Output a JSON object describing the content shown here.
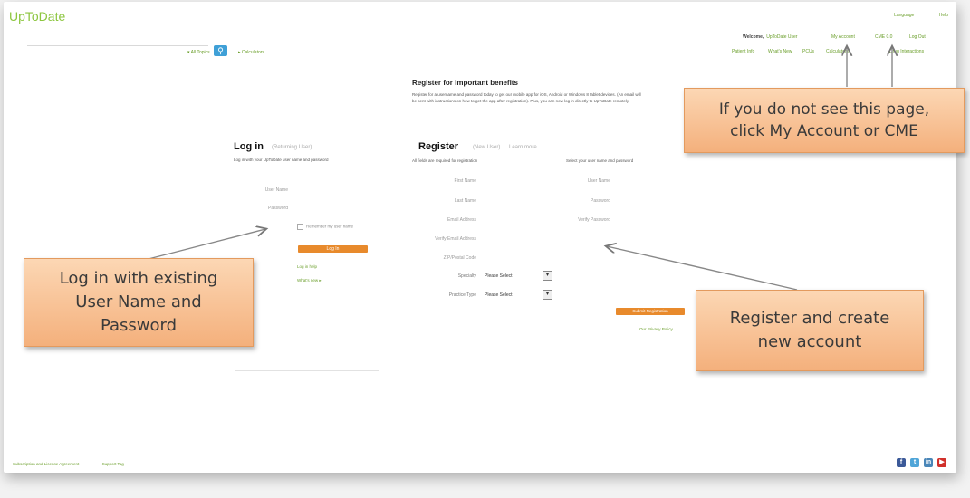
{
  "header": {
    "logo": "UpToDate",
    "top_links": [
      "Language",
      "Help"
    ],
    "search": {
      "topics_label": "▾ All Topics",
      "search_icon": "search-icon",
      "calculators_label": "▸ Calculators"
    },
    "welcome_label": "Welcome,",
    "welcome_name": "UpToDate User",
    "account_links": [
      "My Account",
      "CME 0.0",
      "Log Out"
    ],
    "nav": [
      "Patient Info",
      "What's New",
      "PCUs",
      "Calculators",
      "Drug Interactions"
    ]
  },
  "register_benefits": {
    "heading": "Register for important benefits",
    "blurb": "Register for a username and password today to get our mobile app for iOS, Android or Windows 8 tablet devices. (An email will be sent with instructions on how to get the app after registration). Plus, you can now log in directly to UpToDate remotely."
  },
  "login": {
    "title": "Log in",
    "subtitle": "(Returning User)",
    "description": "Log in with your UpToDate user name and password",
    "fields": [
      "User Name",
      "Password"
    ],
    "remember_label": "Remember my user name",
    "button": "Log In",
    "links": [
      "Log in help",
      "What's new ▸"
    ]
  },
  "register": {
    "title": "Register",
    "subtitle": "(New User)",
    "subtitle2": "Learn more",
    "required_note": "All fields are required for registration",
    "choose_note": "Select your user name and password",
    "left_fields": [
      "First Name",
      "Last Name",
      "Email Address",
      "Verify Email Address",
      "ZIP/Postal Code"
    ],
    "right_fields": [
      "User Name",
      "Password",
      "Verify Password"
    ],
    "selects": [
      {
        "label": "Specialty",
        "value": "Please Select"
      },
      {
        "label": "Practice Type",
        "value": "Please Select"
      }
    ],
    "submit": "Submit Registration",
    "privacy_link": "Our Privacy Policy"
  },
  "footer": {
    "links": [
      "Subscription and License Agreement",
      "Support Tag"
    ],
    "social": [
      "facebook-icon",
      "twitter-icon",
      "linkedin-icon",
      "youtube-icon"
    ]
  },
  "callouts": {
    "top": "If you do not see this page,\nclick My Account or CME",
    "login": "Log in with existing\nUser Name and\nPassword",
    "register": "Register and create\nnew account"
  },
  "colors": {
    "accent_green": "#6a9e2a",
    "button_orange": "#e88a2c",
    "callout": "#f6c195",
    "search_blue": "#3fa0d7"
  }
}
